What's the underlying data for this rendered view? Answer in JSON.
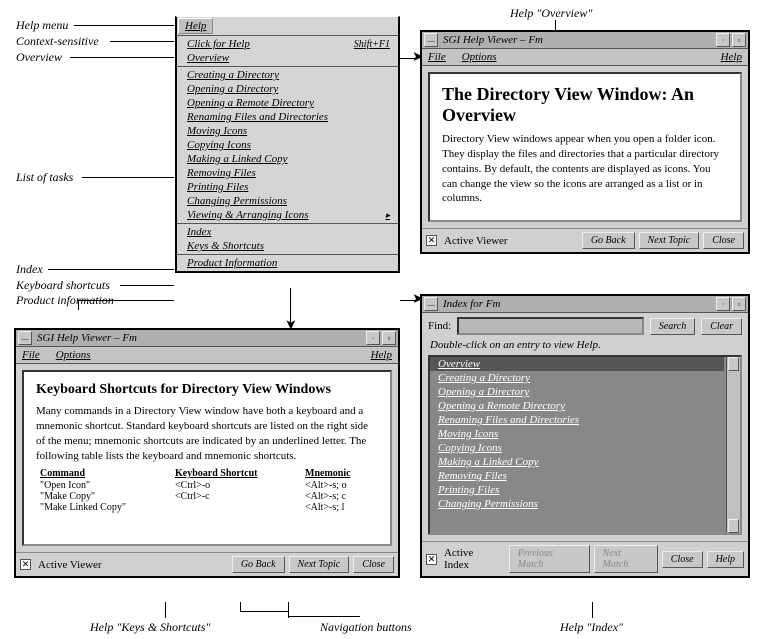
{
  "annotations": {
    "help_menu": "Help menu",
    "context_sensitive": "Context-sensitive",
    "overview": "Overview",
    "list_of_tasks": "List of tasks",
    "index_label": "Index",
    "keyboard_shortcuts": "Keyboard shortcuts",
    "product_information": "Product information",
    "help_overview_callout": "Help \"Overview\"",
    "help_keys_callout": "Help \"Keys & Shortcuts\"",
    "nav_buttons_callout": "Navigation buttons",
    "help_index_callout": "Help \"Index\""
  },
  "help_menu": {
    "title": "Help",
    "click_for_help": "Click for Help",
    "click_shortcut": "Shift+F1",
    "overview": "Overview",
    "tasks": [
      "Creating a Directory",
      "Opening a Directory",
      "Opening a Remote Directory",
      "Renaming Files and Directories",
      "Moving Icons",
      "Copying Icons",
      "Making a Linked Copy",
      "Removing Files",
      "Printing Files",
      "Changing Permissions",
      "Viewing & Arranging Icons"
    ],
    "index": "Index",
    "keys": "Keys & Shortcuts",
    "product_info": "Product Information"
  },
  "overview_win": {
    "title": "SGI Help Viewer – Fm",
    "menubar": {
      "file": "File",
      "options": "Options",
      "help": "Help"
    },
    "heading": "The Directory View Window: An Overview",
    "body": "Directory View windows appear when you open a folder icon. They display the files and directories that a particular directory contains. By default, the contents are displayed as icons. You can change the view so the icons are arranged as a list or in columns.",
    "active": "Active Viewer",
    "go_back": "Go Back",
    "next_topic": "Next Topic",
    "close": "Close"
  },
  "keys_win": {
    "title": "SGI Help Viewer – Fm",
    "menubar": {
      "file": "File",
      "options": "Options",
      "help": "Help"
    },
    "heading": "Keyboard Shortcuts for Directory View Windows",
    "body": "Many commands in a Directory View window have both a keyboard and a mnemonic shortcut. Standard keyboard shortcuts are listed on the right side of the menu; mnemonic shortcuts are indicated by an underlined letter. The following table lists the keyboard and mnemonic shortcuts.",
    "col_command": "Command",
    "col_keyboard": "Keyboard Shortcut",
    "col_mnemonic": "Mnemonic",
    "rows": [
      {
        "cmd": "\"Open Icon\"",
        "kb": "<Ctrl>-o",
        "mn": "<Alt>-s; o"
      },
      {
        "cmd": "\"Make Copy\"",
        "kb": "<Ctrl>-c",
        "mn": "<Alt>-s; c"
      },
      {
        "cmd": "\"Make Linked Copy\"",
        "kb": "",
        "mn": "<Alt>-s; l"
      }
    ],
    "active": "Active Viewer",
    "go_back": "Go Back",
    "next_topic": "Next Topic",
    "close": "Close"
  },
  "index_win": {
    "title": "Index for Fm",
    "find_label": "Find:",
    "search": "Search",
    "clear": "Clear",
    "dbl_msg": "Double-click on an entry to view Help.",
    "items": [
      "Overview",
      "Creating a Directory",
      "Opening a Directory",
      "Opening a Remote Directory",
      "Renaming Files and Directories",
      "Moving Icons",
      "Copying Icons",
      "Making a Linked Copy",
      "Removing Files",
      "Printing Files",
      "Changing Permissions"
    ],
    "active": "Active Index",
    "prev": "Previous Match",
    "next": "Next Match",
    "close": "Close",
    "help": "Help"
  }
}
